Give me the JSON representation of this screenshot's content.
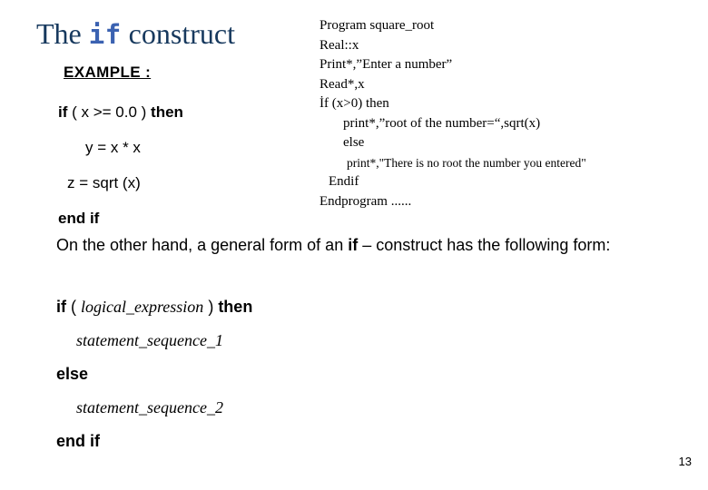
{
  "slide": {
    "page_number": "13",
    "title": {
      "before": "The ",
      "keyword": "if",
      "after": " construct"
    },
    "colors": {
      "title_text": "#17395e",
      "title_keyword": "#3b62b1",
      "body_text": "#000000",
      "background": "#ffffff"
    },
    "example": {
      "heading": "EXAMPLE :",
      "lines": [
        {
          "indent": 0,
          "segments": [
            {
              "text": "if",
              "bold": true
            },
            {
              "text": " ( x >= 0.0 )  ",
              "bold": false
            },
            {
              "text": "then",
              "bold": true
            }
          ]
        },
        {
          "indent": 2,
          "segments": [
            {
              "text": "y = x * x",
              "bold": false
            }
          ]
        },
        {
          "indent": 2,
          "segments": [
            {
              "text": "z = sqrt (x)",
              "bold": false
            }
          ]
        },
        {
          "indent": 0,
          "segments": [
            {
              "text": "end if",
              "bold": true
            }
          ]
        }
      ]
    },
    "program_listing": {
      "lines": [
        {
          "indent": 0,
          "text": "Program square_root"
        },
        {
          "indent": 0,
          "text": "Real::x"
        },
        {
          "indent": 0,
          "text": "Print*,”Enter a number”"
        },
        {
          "indent": 0,
          "text": "Read*,x"
        },
        {
          "indent": 0,
          "text": "İf (x>0) then"
        },
        {
          "indent": 1,
          "text": "print*,”root of the number=“,sqrt(x)"
        },
        {
          "indent": 1,
          "text": "else"
        },
        {
          "indent": 2,
          "text": "print*,\"There is no root the number you entered\"",
          "small": true
        },
        {
          "indent": 3,
          "text": "Endif"
        },
        {
          "indent": 0,
          "text": "Endprogram ......"
        }
      ]
    },
    "body_paragraph": {
      "part1": "On the other hand, a general form of an  ",
      "keyword": "if",
      "part2": " – construct has the following form:"
    },
    "general_form": {
      "line1": {
        "keyword_if": "if",
        "open": " ( ",
        "expression": "logical_expression",
        "close": " )  ",
        "keyword_then": "then"
      },
      "statement_1": "statement_sequence_1",
      "keyword_else": "else",
      "statement_2": "statement_sequence_2",
      "keyword_end_if": "end if"
    }
  }
}
